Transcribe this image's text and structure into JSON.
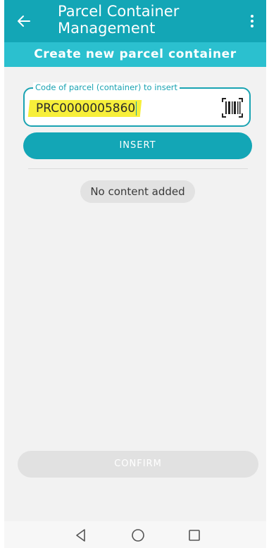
{
  "appbar": {
    "title": "Parcel Container Management",
    "icons": {
      "back": "arrow-left-icon",
      "menu": "more-vertical-icon"
    },
    "color": "#13a6b6"
  },
  "subheader": {
    "text": "Create new parcel container",
    "color": "#2bc0cf"
  },
  "code_field": {
    "label": "Code of parcel (container) to insert",
    "value": "PRC0000005860",
    "icon": "barcode-scan-icon",
    "highlight_color": "#f7ef3a"
  },
  "actions": {
    "insert_label": "INSERT",
    "confirm_label": "CONFIRM"
  },
  "content": {
    "empty_message": "No content added"
  },
  "navbar": {
    "icons": [
      "back-triangle-icon",
      "home-circle-icon",
      "recents-square-icon"
    ]
  }
}
